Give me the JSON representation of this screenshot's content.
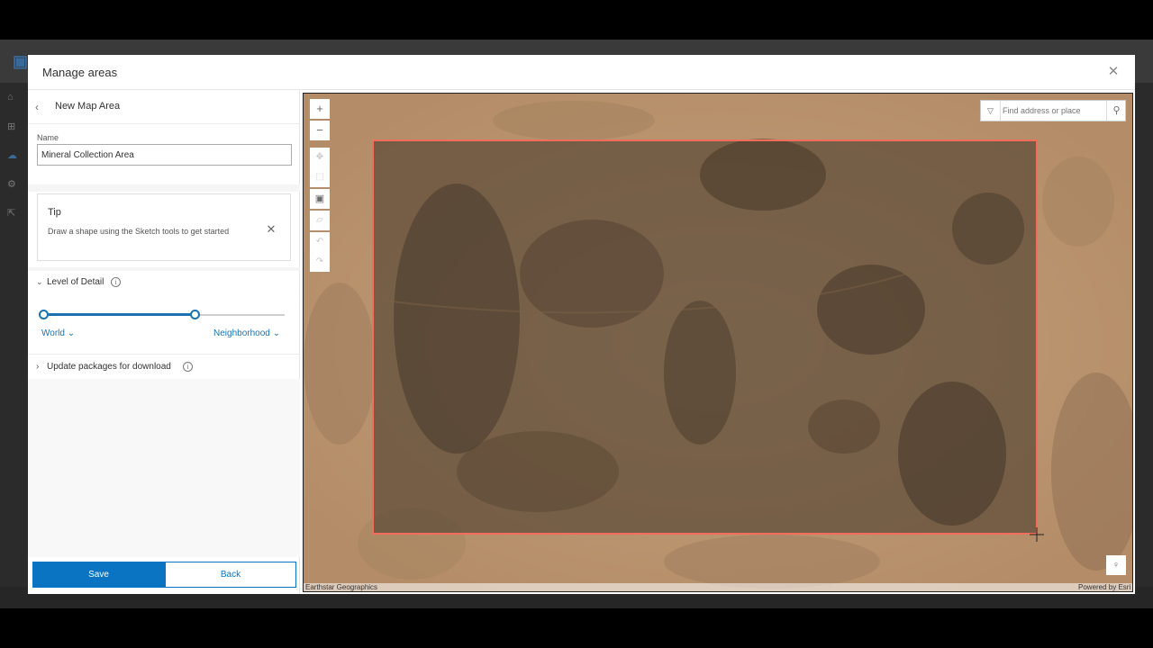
{
  "modal": {
    "title": "Manage areas",
    "close_glyph": "✕"
  },
  "panel": {
    "back_glyph": "‹",
    "title": "New Map Area",
    "name_label": "Name",
    "name_value": "Mineral Collection Area",
    "tip": {
      "title": "Tip",
      "body": "Draw a shape using the Sketch tools to get started",
      "close_glyph": "✕"
    },
    "level_of_detail": {
      "label": "Level of Detail",
      "expanded": true,
      "min_label": "World",
      "max_label": "Neighborhood",
      "min_position": 0.0,
      "max_position": 0.63
    },
    "update_packages": {
      "label": "Update packages for download",
      "expanded": false
    },
    "info_glyph": "i",
    "save_label": "Save",
    "back_label": "Back"
  },
  "map": {
    "search_placeholder": "Find address or place",
    "attribution_left": "Earthstar Geographics",
    "attribution_right": "Powered by Esri",
    "tools": {
      "zoom_in": "+",
      "zoom_out": "−"
    },
    "selection_color": "#f26d5b"
  },
  "icons": {
    "back": "chevron-left-icon",
    "close": "close-icon",
    "info": "info-icon",
    "search": "search-icon",
    "bulb": "lightbulb-icon"
  },
  "colors": {
    "accent": "#0a74c2",
    "selection_outline": "#f26d5b"
  }
}
